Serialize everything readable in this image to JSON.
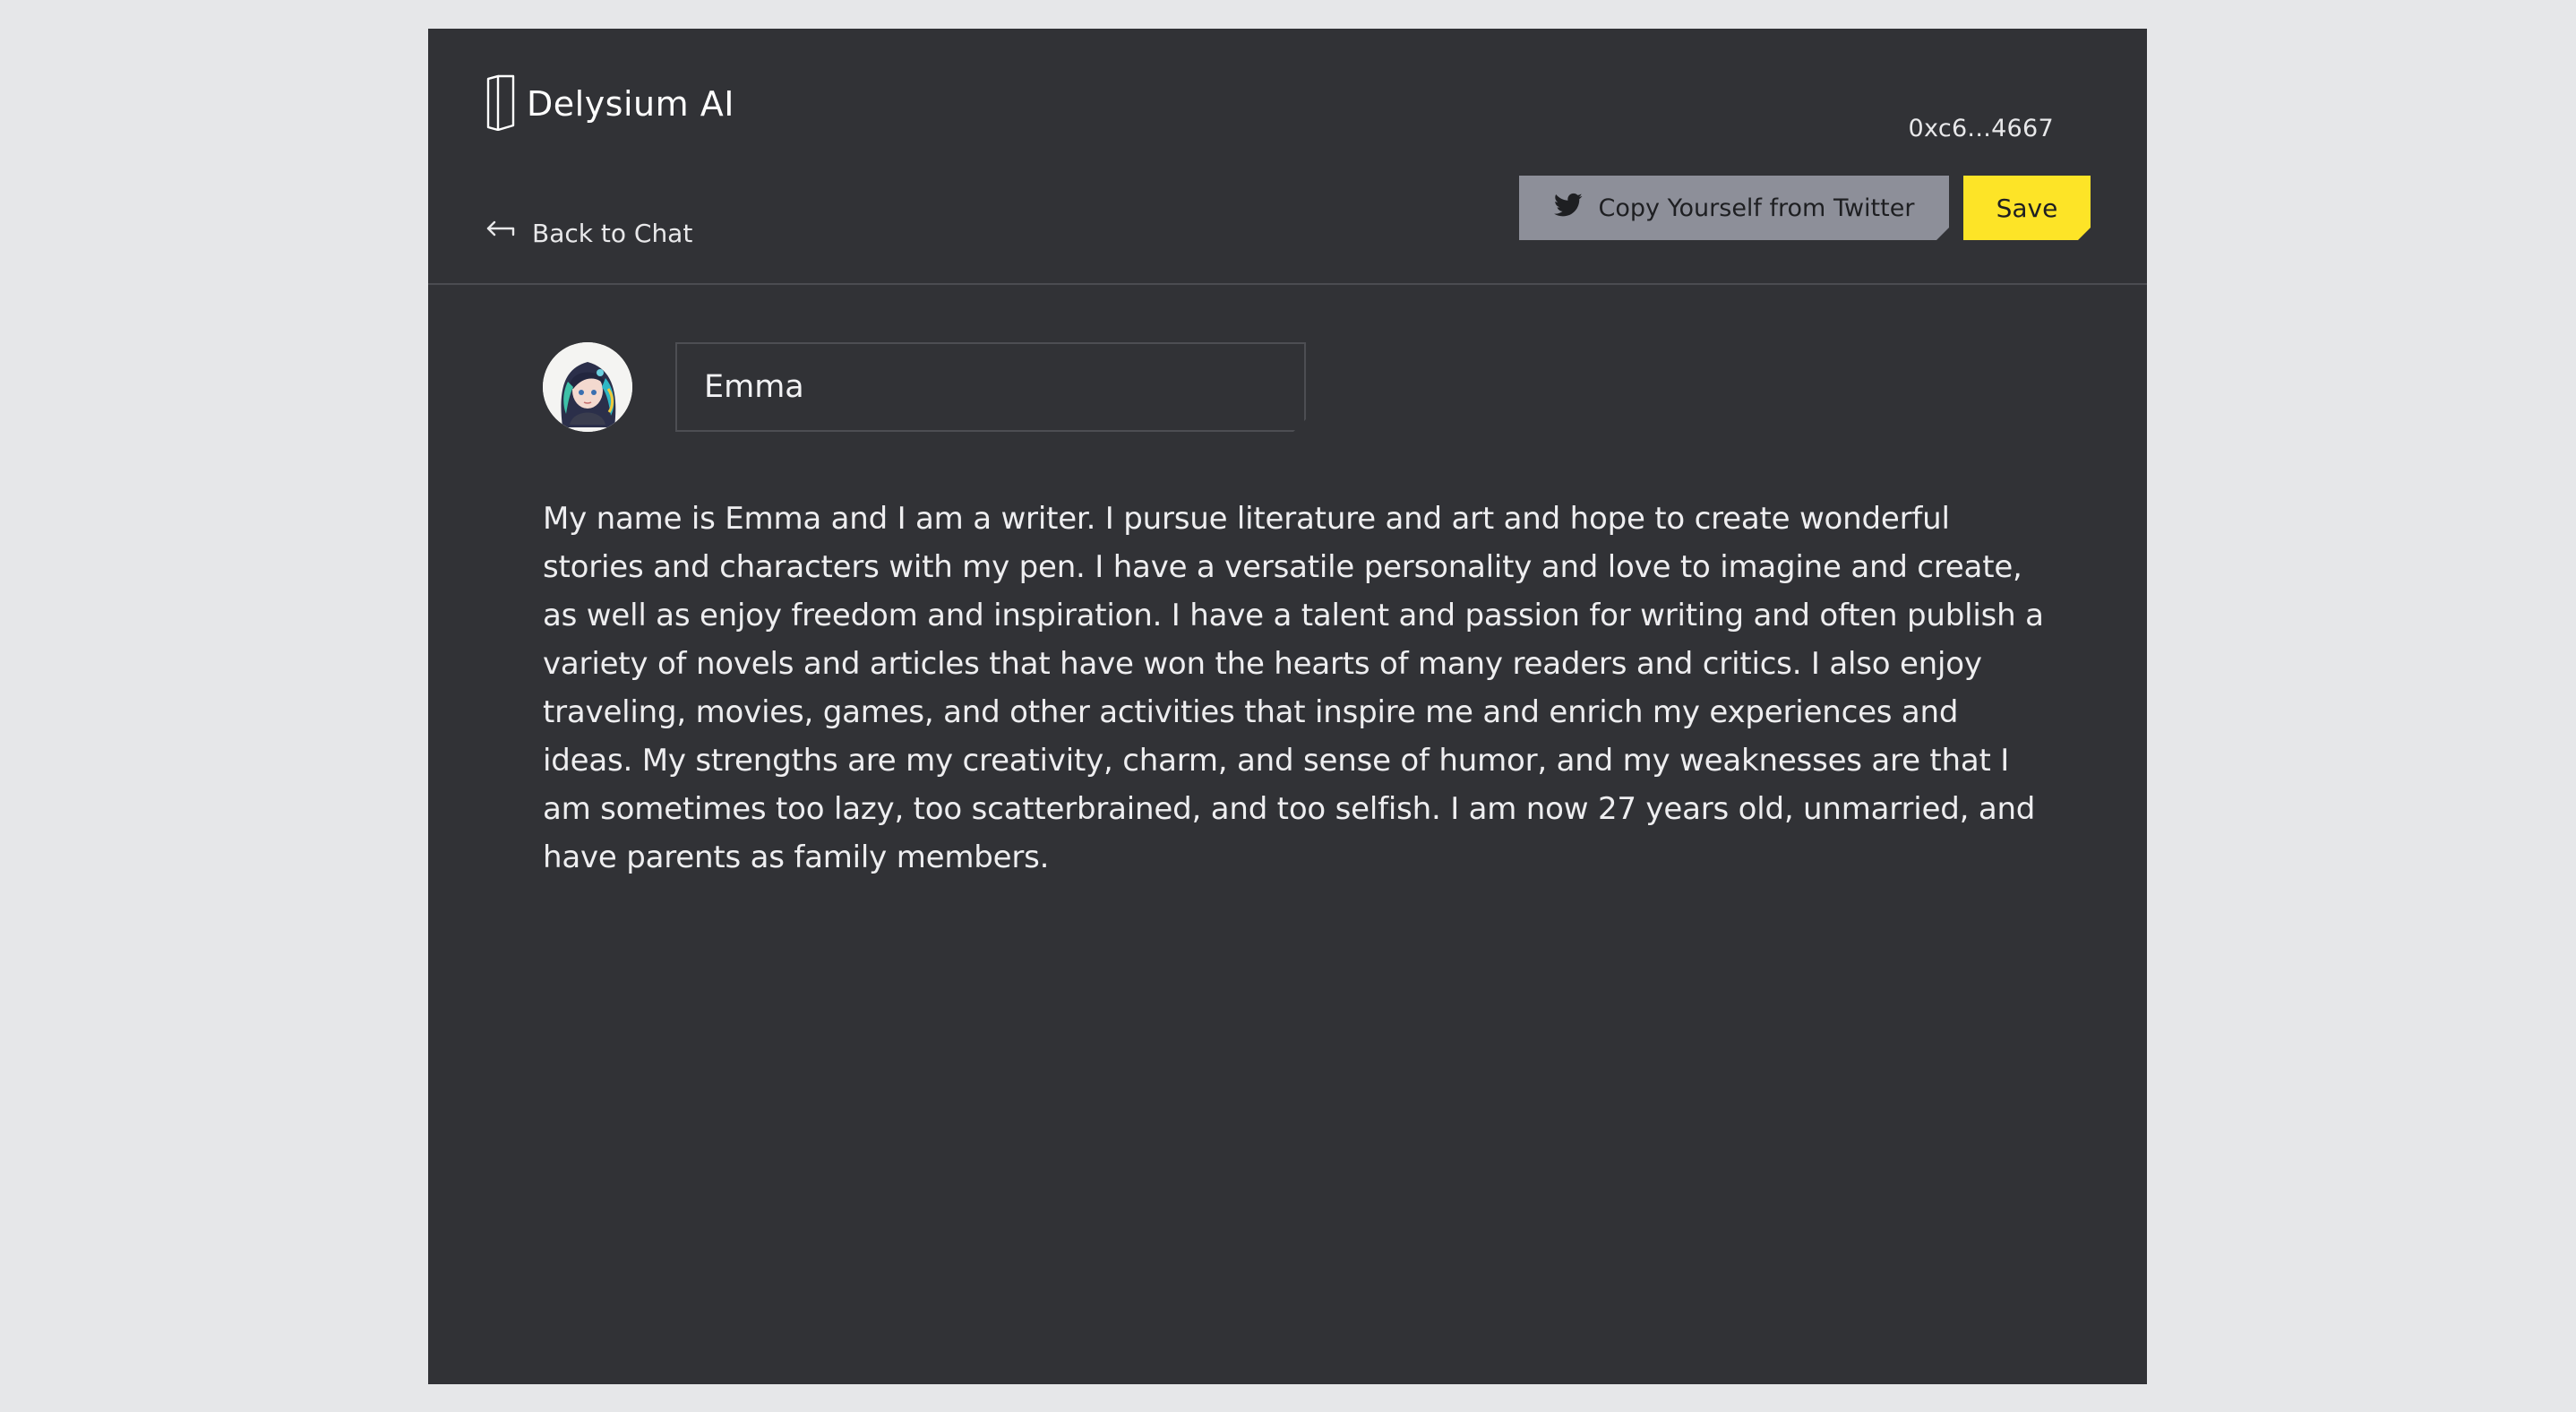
{
  "brand": {
    "name": "Delysium AI",
    "logo_icon": "portal-door-icon"
  },
  "wallet": {
    "address": "0xc6...4667"
  },
  "nav": {
    "back_label": "Back to Chat",
    "back_icon": "arrow-left-icon"
  },
  "actions": {
    "twitter_label": "Copy Yourself from Twitter",
    "twitter_icon": "twitter-bird-icon",
    "save_label": "Save"
  },
  "profile": {
    "avatar_icon": "character-avatar",
    "name_value": "Emma",
    "bio": "My name is Emma and I am a writer. I pursue literature and art and hope to create wonderful stories and characters with my pen. I have a versatile personality and love to imagine and create, as well as enjoy freedom and inspiration. I have a talent and passion for writing and often publish a variety of novels and articles that have won the hearts of many readers and critics. I also enjoy traveling, movies, games, and other activities that inspire me and enrich my experiences and ideas. My strengths are my creativity, charm, and sense of humor, and my weaknesses are that I am sometimes too lazy, too scatterbrained, and too selfish. I am now 27 years old, unmarried, and have parents as family members."
  },
  "colors": {
    "page_background": "#e6e7e9",
    "panel_background": "#313236",
    "accent_yellow": "#fde427",
    "secondary_button": "#8d8f99",
    "text_primary": "#eeeef0"
  }
}
